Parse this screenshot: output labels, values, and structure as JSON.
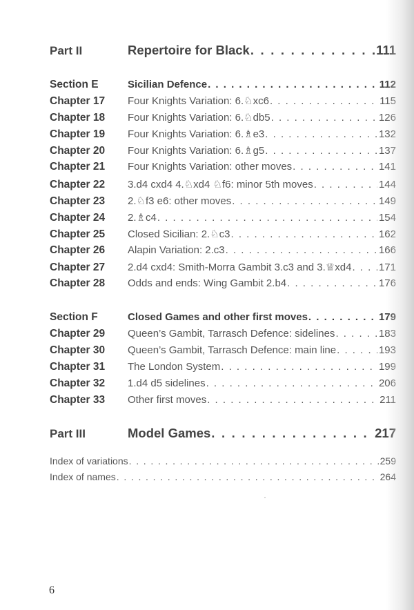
{
  "toc": {
    "part_ii": {
      "label": "Part II",
      "title": "Repertoire for Black",
      "page": "111"
    },
    "section_e": {
      "label": "Section E",
      "title": "Sicilian Defence",
      "page": "112"
    },
    "section_e_chapters": [
      {
        "label": "Chapter 17",
        "title": "Four Knights Variation: 6.♘xc6",
        "page": "115"
      },
      {
        "label": "Chapter 18",
        "title": "Four Knights Variation: 6.♘db5",
        "page": "126"
      },
      {
        "label": "Chapter 19",
        "title": "Four Knights Variation: 6.♗e3",
        "page": "132"
      },
      {
        "label": "Chapter 20",
        "title": "Four Knights Variation: 6.♗g5",
        "page": "137"
      },
      {
        "label": "Chapter 21",
        "title": "Four Knights Variation: other moves",
        "page": "141"
      },
      {
        "label": "Chapter 22",
        "title": "3.d4 cxd4 4.♘xd4 ♘f6: minor 5th moves",
        "page": "144"
      },
      {
        "label": "Chapter 23",
        "title": "2.♘f3 e6: other moves",
        "page": "149"
      },
      {
        "label": "Chapter 24",
        "title": "2.♗c4",
        "page": "154"
      },
      {
        "label": "Chapter 25",
        "title": "Closed Sicilian: 2.♘c3",
        "page": "162"
      },
      {
        "label": "Chapter 26",
        "title": "Alapin Variation: 2.c3",
        "page": "166"
      },
      {
        "label": "Chapter 27",
        "title": "2.d4 cxd4: Smith-Morra Gambit 3.c3 and 3.♕xd4",
        "page": "171"
      },
      {
        "label": "Chapter 28",
        "title": "Odds and ends: Wing Gambit 2.b4",
        "page": "176"
      }
    ],
    "section_f": {
      "label": "Section F",
      "title": "Closed Games and other first moves",
      "page": "179"
    },
    "section_f_chapters": [
      {
        "label": "Chapter 29",
        "title": "Queen’s Gambit, Tarrasch Defence: sidelines",
        "page": "183"
      },
      {
        "label": "Chapter 30",
        "title": "Queen’s Gambit, Tarrasch Defence: main line",
        "page": "193"
      },
      {
        "label": "Chapter 31",
        "title": "The London System",
        "page": "199"
      },
      {
        "label": "Chapter 32",
        "title": "1.d4 d5 sidelines",
        "page": "206"
      },
      {
        "label": "Chapter 33",
        "title": "Other first moves",
        "page": "211"
      }
    ],
    "part_iii": {
      "label": "Part III",
      "title": "Model Games",
      "page": "217"
    },
    "indexes": [
      {
        "title": "Index of variations",
        "page": "259"
      },
      {
        "title": "Index of names",
        "page": "264"
      }
    ]
  },
  "footer": {
    "page_number": "6"
  }
}
